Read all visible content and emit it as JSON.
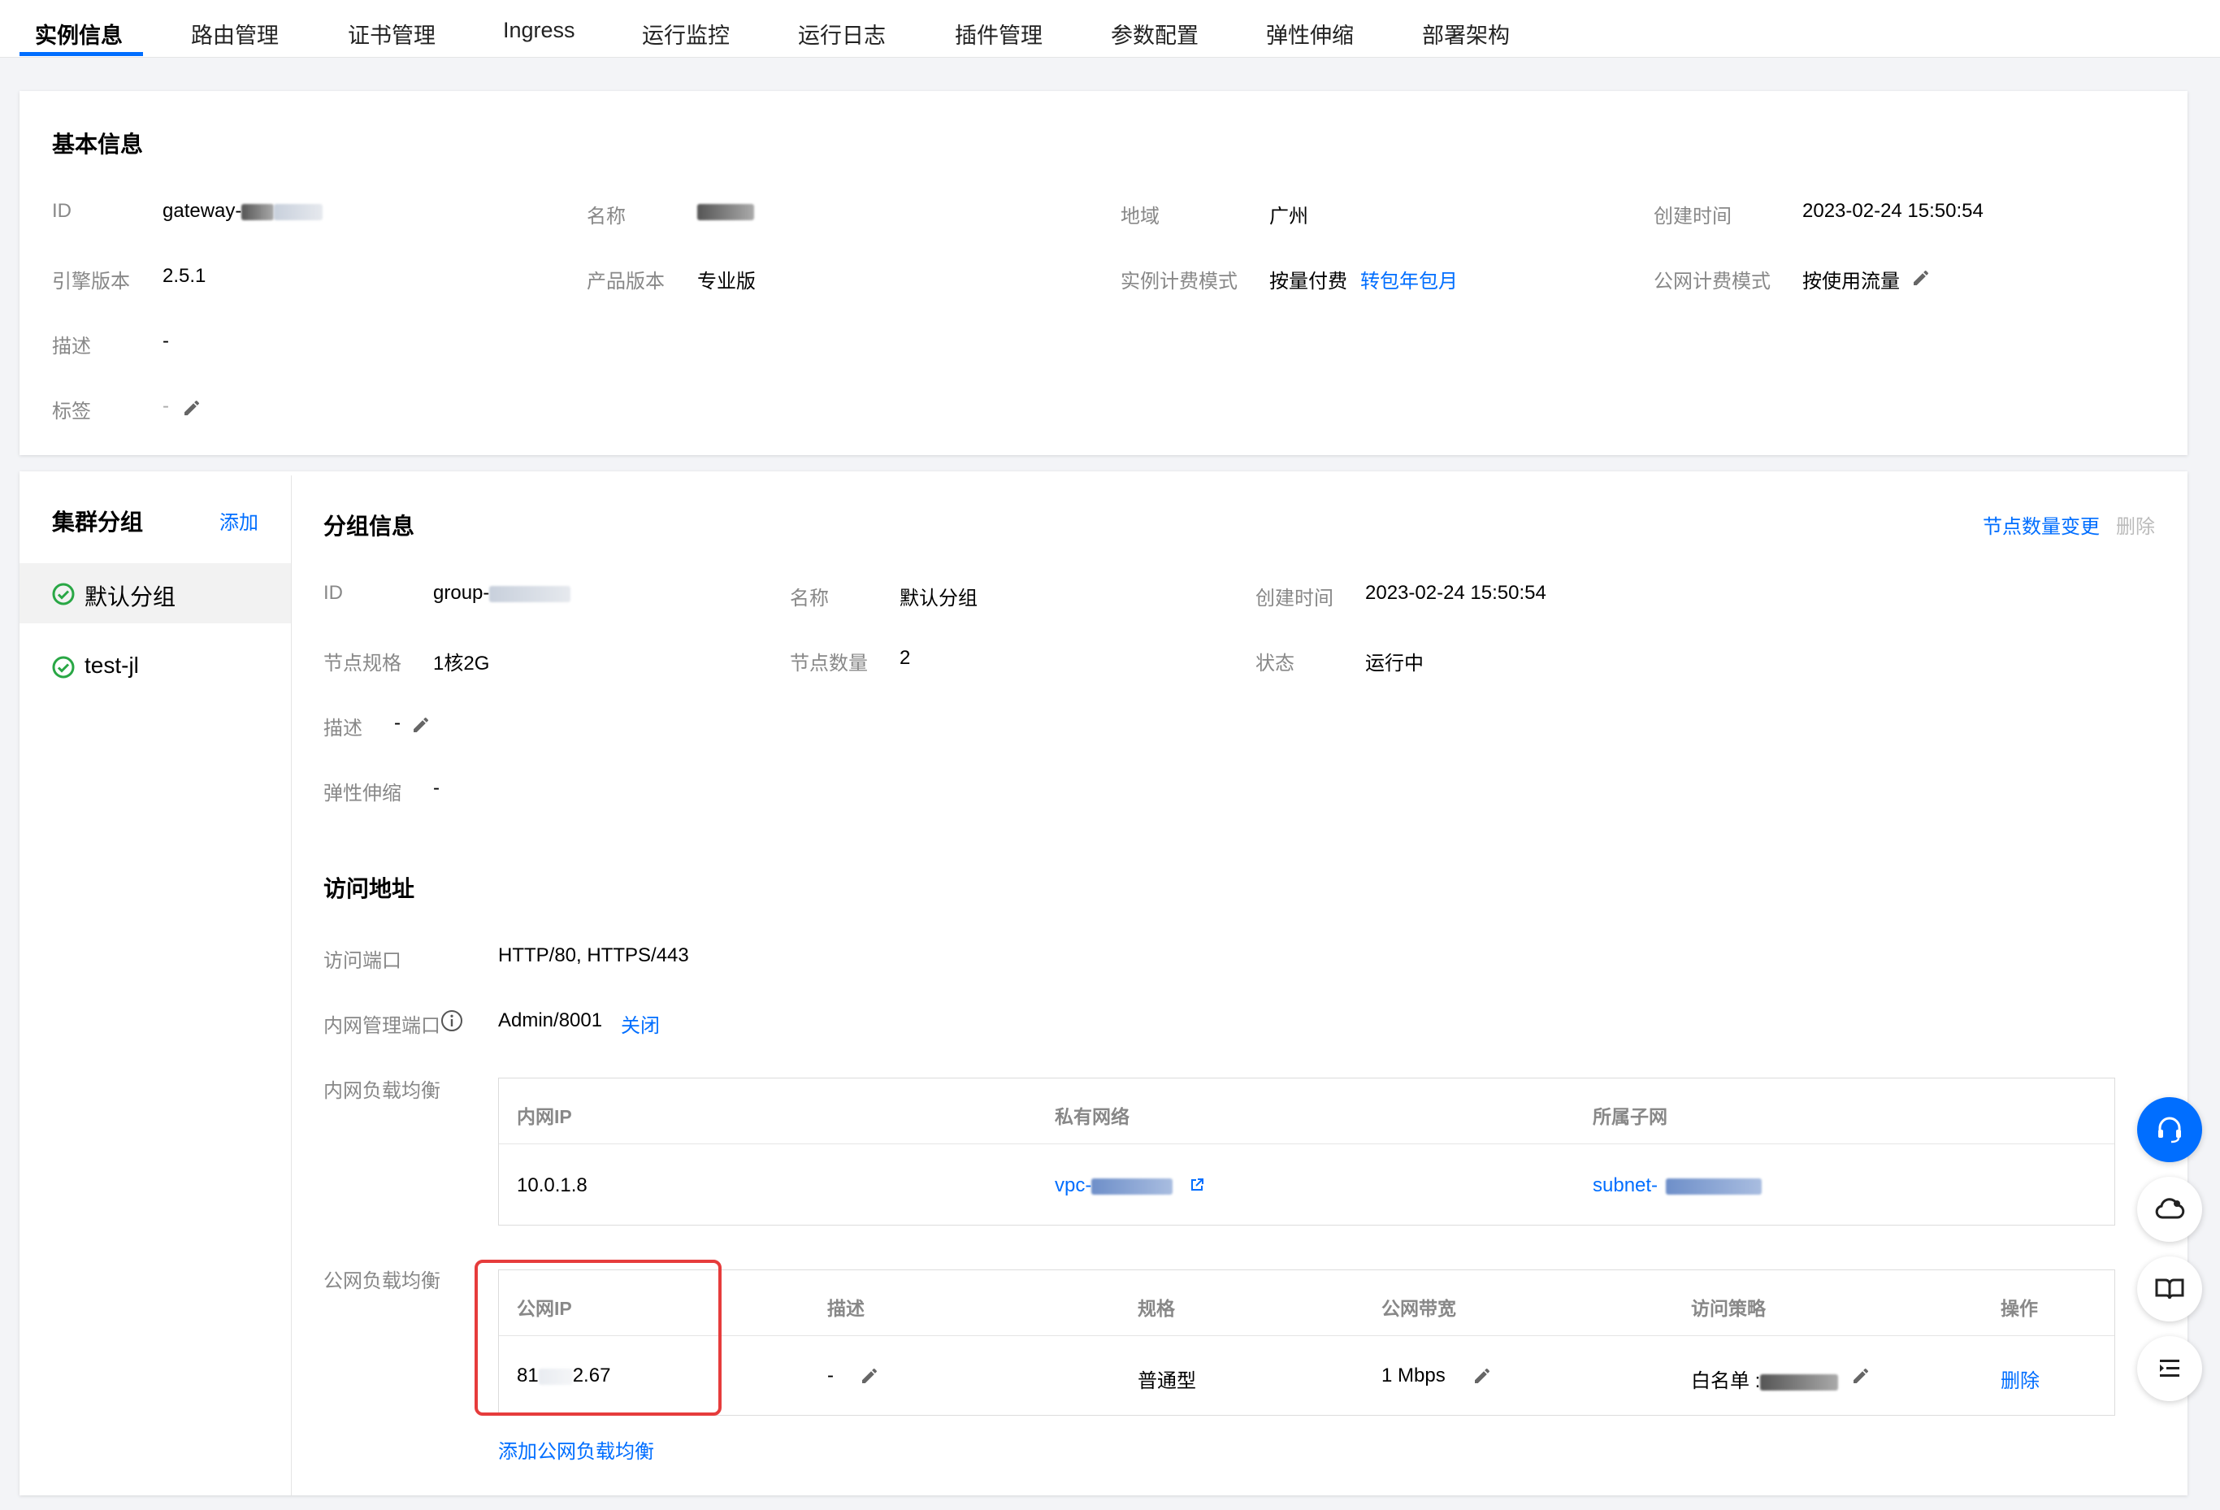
{
  "tabs": [
    {
      "label": "实例信息",
      "active": true
    },
    {
      "label": "路由管理"
    },
    {
      "label": "证书管理"
    },
    {
      "label": "Ingress"
    },
    {
      "label": "运行监控"
    },
    {
      "label": "运行日志"
    },
    {
      "label": "插件管理"
    },
    {
      "label": "参数配置"
    },
    {
      "label": "弹性伸缩"
    },
    {
      "label": "部署架构"
    }
  ],
  "basic_info": {
    "title": "基本信息",
    "id_label": "ID",
    "id_value": "gateway-",
    "name_label": "名称",
    "name_value": "test-jl",
    "region_label": "地域",
    "region_value": "广州",
    "created_label": "创建时间",
    "created_value": "2023-02-24 15:50:54",
    "engine_label": "引擎版本",
    "engine_value": "2.5.1",
    "edition_label": "产品版本",
    "edition_value": "专业版",
    "billing_label": "实例计费模式",
    "billing_value": "按量付费",
    "billing_link": "转包年包月",
    "net_billing_label": "公网计费模式",
    "net_billing_value": "按使用流量",
    "desc_label": "描述",
    "desc_value": "-",
    "tags_label": "标签",
    "tags_value": "-"
  },
  "cluster": {
    "title": "集群分组",
    "add_label": "添加",
    "groups": [
      {
        "label": "默认分组",
        "selected": true
      },
      {
        "label": "test-jl"
      }
    ]
  },
  "group_info": {
    "title": "分组信息",
    "change_nodes": "节点数量变更",
    "delete": "删除",
    "id_label": "ID",
    "id_value": "group-",
    "name_label": "名称",
    "name_value": "默认分组",
    "created_label": "创建时间",
    "created_value": "2023-02-24 15:50:54",
    "spec_label": "节点规格",
    "spec_value": "1核2G",
    "count_label": "节点数量",
    "count_value": "2",
    "status_label": "状态",
    "status_value": "运行中",
    "desc_label": "描述",
    "desc_value": "-",
    "scale_label": "弹性伸缩",
    "scale_value": "-"
  },
  "access": {
    "title": "访问地址",
    "port_label": "访问端口",
    "port_value": "HTTP/80, HTTPS/443",
    "admin_label": "内网管理端口",
    "admin_value": "Admin/8001",
    "admin_action": "关闭",
    "internal_lb_label": "内网负载均衡",
    "internal_table": {
      "headers": [
        "内网IP",
        "私有网络",
        "所属子网"
      ],
      "ip": "10.0.1.8",
      "vpc": "vpc-",
      "subnet": "subnet-"
    },
    "public_lb_label": "公网负载均衡",
    "public_table": {
      "headers": [
        "公网IP",
        "描述",
        "规格",
        "公网带宽",
        "访问策略",
        "操作"
      ],
      "ip_prefix": "81",
      "ip_suffix": "2.67",
      "desc": "-",
      "spec": "普通型",
      "bandwidth": "1 Mbps",
      "policy": "白名单 :",
      "action": "删除"
    },
    "add_public_lb": "添加公网负载均衡"
  },
  "floating_icons": [
    "headset-icon",
    "cloud-bell-icon",
    "book-icon",
    "list-indent-icon"
  ],
  "colors": {
    "accent": "#006eff",
    "success": "#29a745",
    "highlight": "#e63c3c"
  }
}
